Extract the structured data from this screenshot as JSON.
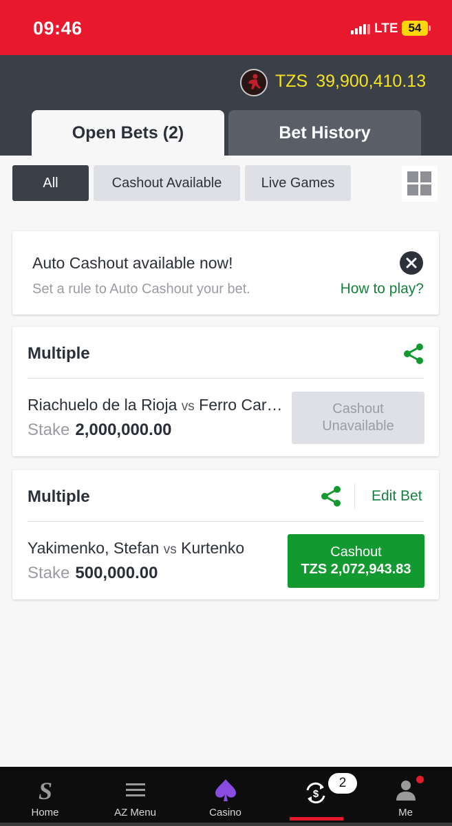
{
  "status_bar": {
    "time": "09:46",
    "network": "LTE",
    "battery": "54"
  },
  "header": {
    "balance_currency": "TZS",
    "balance_amount": "39,900,410.13",
    "tabs": [
      {
        "label": "Open Bets (2)",
        "active": true
      },
      {
        "label": "Bet History",
        "active": false
      }
    ]
  },
  "filters": [
    {
      "label": "All",
      "active": true
    },
    {
      "label": "Cashout Available",
      "active": false
    },
    {
      "label": "Live Games",
      "active": false
    }
  ],
  "promo": {
    "title": "Auto Cashout available now!",
    "subtitle": "Set a rule to Auto Cashout your bet.",
    "link": "How to play?"
  },
  "bets": [
    {
      "type": "Multiple",
      "home": "Riachuelo de la Rioja",
      "vs": "vs",
      "away": "Ferro Carril Oeste",
      "stake_label": "Stake",
      "stake": "2,000,000.00",
      "cashout_line1": "Cashout",
      "cashout_line2": "Unavailable"
    },
    {
      "type": "Multiple",
      "edit_label": "Edit Bet",
      "home": "Yakimenko, Stefan",
      "vs": "vs",
      "away": "Kurtenko",
      "stake_label": "Stake",
      "stake": "500,000.00",
      "cashout_line1": "Cashout",
      "cashout_line2": "TZS 2,072,943.83"
    }
  ],
  "bottom_nav": {
    "items": [
      {
        "label": "Home",
        "icon": "home-s-icon"
      },
      {
        "label": "AZ Menu",
        "icon": "menu-icon"
      },
      {
        "label": "Casino",
        "icon": "spade-icon"
      },
      {
        "label": "",
        "icon": "cashout-icon"
      },
      {
        "label": "Me",
        "icon": "user-icon"
      }
    ],
    "badge_count": "2"
  },
  "colors": {
    "brand_red": "#e8192c",
    "header_dark": "#3b3f47",
    "accent_green": "#12992f",
    "balance_yellow": "#f4e31d"
  }
}
